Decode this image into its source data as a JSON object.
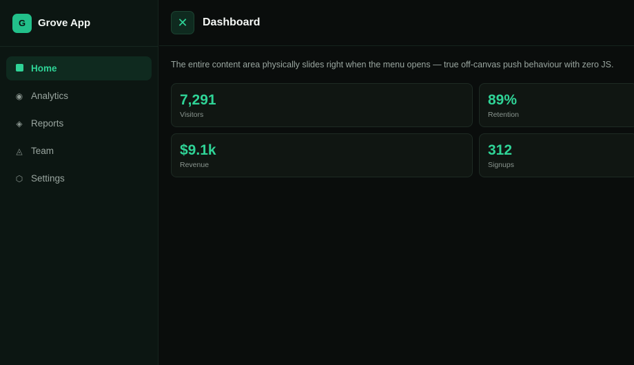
{
  "brand": {
    "logo_letter": "G",
    "name": "Grove App"
  },
  "nav": {
    "items": [
      {
        "label": "Home",
        "icon": "square-icon",
        "glyph": "",
        "active": true
      },
      {
        "label": "Analytics",
        "icon": "circle-dot-icon",
        "glyph": "◉",
        "active": false
      },
      {
        "label": "Reports",
        "icon": "diamond-icon",
        "glyph": "◈",
        "active": false
      },
      {
        "label": "Team",
        "icon": "triangle-icon",
        "glyph": "◬",
        "active": false
      },
      {
        "label": "Settings",
        "icon": "hexagon-icon",
        "glyph": "⬡",
        "active": false
      }
    ]
  },
  "header": {
    "close_glyph": "✕",
    "title": "Dashboard"
  },
  "main": {
    "description": "The entire content area physically slides right when the menu opens — true off-canvas push behaviour with zero JS.",
    "stats": [
      {
        "value": "7,291",
        "label": "Visitors"
      },
      {
        "value": "89%",
        "label": "Retention"
      },
      {
        "value": "$9.1k",
        "label": "Revenue"
      },
      {
        "value": "312",
        "label": "Signups"
      }
    ]
  },
  "colors": {
    "accent": "#2fd497",
    "background": "#0a0d0c",
    "sidebar": "#0c1612"
  }
}
